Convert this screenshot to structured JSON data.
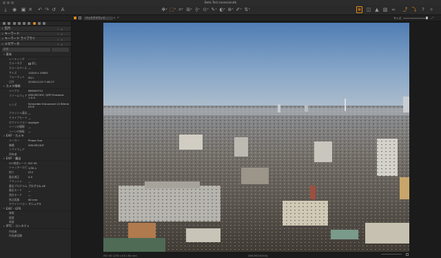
{
  "window": {
    "title": "Beta Test.cosessiondb"
  },
  "toolbar": {
    "viewer_mode": "バックグラウンド",
    "zoom_label": "サイズ"
  },
  "sidebar": {
    "sections": [
      {
        "label": "出力"
      },
      {
        "label": "キーワード"
      },
      {
        "label": "キーワード ライブラリ"
      },
      {
        "label": "メタデータ"
      }
    ],
    "search_placeholder": "名前",
    "groups": [
      {
        "title": "基本",
        "rows": [
          {
            "label": "レーティング",
            "value": "· · · · ·"
          },
          {
            "label": "カラータグ",
            "value": "なし"
          },
          {
            "label": "カラースペース",
            "value": "—"
          },
          {
            "label": "サイズ",
            "value": "14204 x 10652"
          },
          {
            "label": "フォーマット",
            "value": "IIQ L"
          },
          {
            "label": "日付",
            "value": "2018/11/10 7:48:17"
          }
        ]
      },
      {
        "title": "カメラ情報",
        "rows": [
          {
            "label": "シリアル",
            "value": "MM000712"
          },
          {
            "label": "ファームウェア",
            "value": "IXM-RS150F, QSP Firmware 1.0.3.",
            "tall": true
          },
          {
            "label": "レンズ",
            "value": "Schneider Kreuznach LS 80mm f/2.8",
            "tall": true
          },
          {
            "label": "フラッシュ露出",
            "value": "—"
          },
          {
            "label": "ドライブモード",
            "value": "—"
          },
          {
            "label": "ホワイトバランス",
            "value": "daylight"
          },
          {
            "label": "シーンの種類",
            "value": "—"
          },
          {
            "label": "シーンの情報",
            "value": "—"
          }
        ]
      },
      {
        "title": "EXIF - カメラ",
        "rows": [
          {
            "label": "メーカー",
            "value": "Phase One"
          },
          {
            "label": "機種",
            "value": "IXM-RS150F"
          },
          {
            "label": "ソフトウェア",
            "value": ""
          },
          {
            "label": "所有者",
            "value": ""
          }
        ]
      },
      {
        "title": "EXIF - 露出",
        "rows": [
          {
            "label": "ISO感度レーティ",
            "value": "ISO 50"
          },
          {
            "label": "シャッタースピー",
            "value": "1/30 s"
          },
          {
            "label": "絞り",
            "value": "f/11"
          },
          {
            "label": "露出補正",
            "value": "0.0"
          },
          {
            "label": "フラッシュ",
            "value": "—"
          },
          {
            "label": "露出プログラム",
            "value": "プログラム AE"
          },
          {
            "label": "露出モード",
            "value": "—"
          },
          {
            "label": "測光モード",
            "value": "—"
          },
          {
            "label": "焦点距離",
            "value": "80 mm"
          },
          {
            "label": "ホワイトバランス",
            "value": "マニュアル"
          }
        ]
      },
      {
        "title": "EXIF - GPS",
        "rows": [
          {
            "label": "緯度",
            "value": ""
          },
          {
            "label": "経度",
            "value": ""
          },
          {
            "label": "高度",
            "value": ""
          }
        ]
      },
      {
        "title": "IPTC - コンタクト",
        "rows": [
          {
            "label": "作成者",
            "value": ""
          },
          {
            "label": "作成者役職",
            "value": ""
          }
        ]
      }
    ]
  },
  "status": {
    "exposure": "ISO 50    1/30 s    f/11    80 mm",
    "filename": "IXM-RS150F.IIQ"
  },
  "colors": {
    "accent": "#e08a1c",
    "panel": "#262626",
    "sky": "#5a84b4"
  }
}
